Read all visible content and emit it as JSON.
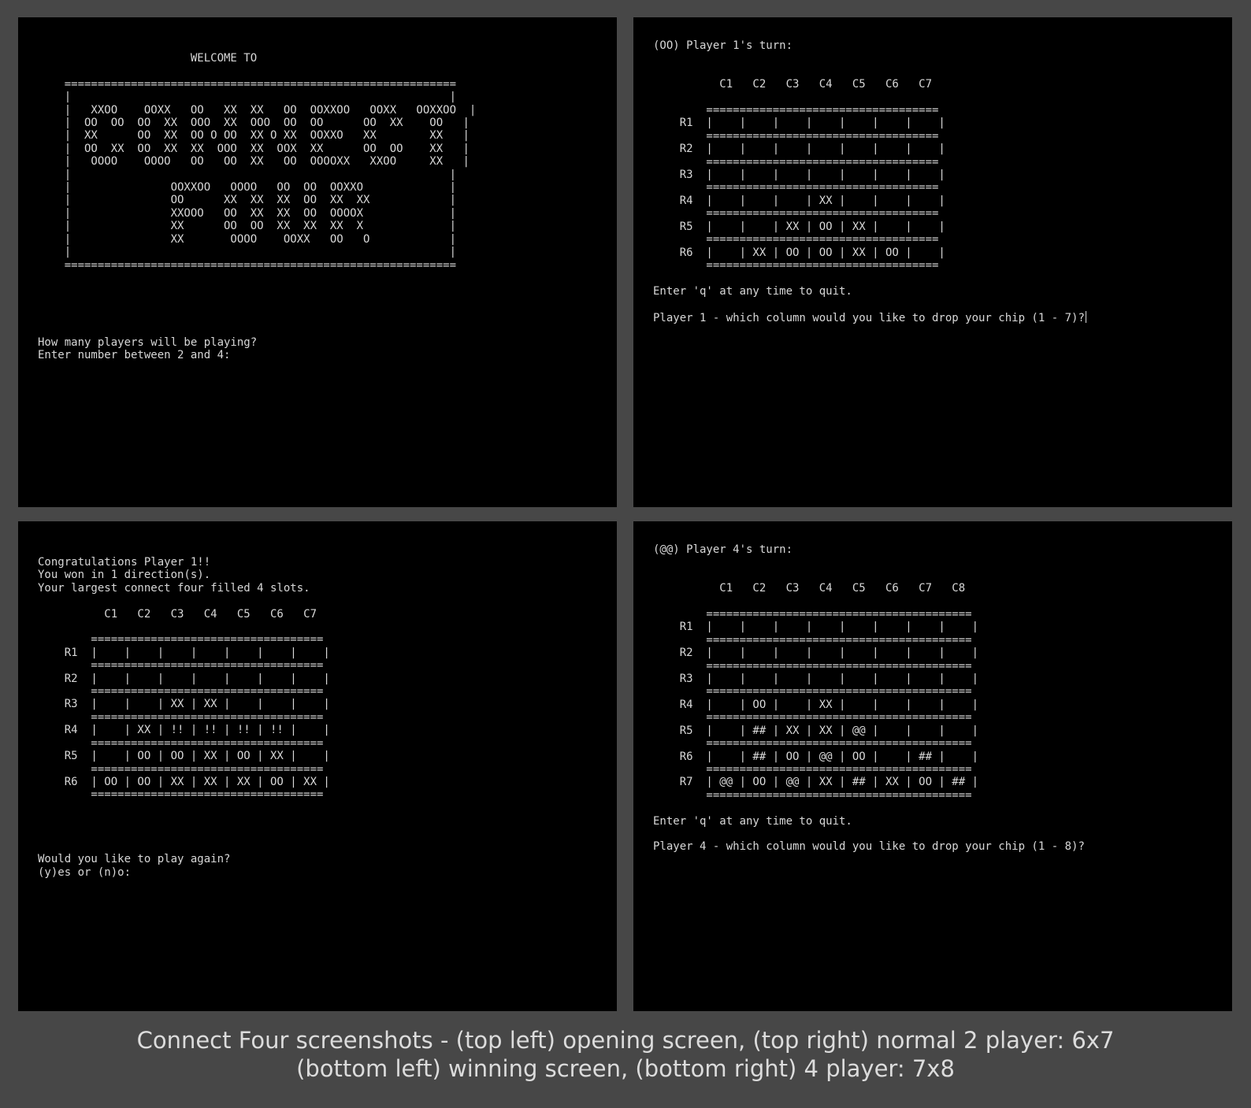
{
  "panels": {
    "opening": {
      "text": "                       WELCOME TO\n\n    ===========================================================\n    |                                                         |\n    |   XXOO    OOXX   OO   XX  XX   OO  OOXXOO   OOXX   OOXXOO  |\n    |  OO  OO  OO  XX  OOO  XX  OOO  OO  OO      OO  XX    OO   |\n    |  XX      OO  XX  OO O OO  XX O XX  OOXXO   XX        XX   |\n    |  OO  XX  OO  XX  XX  OOO  XX  OOX  XX      OO  OO    XX   |\n    |   OOOO    OOOO   OO   OO  XX   OO  OOOOXX   XXOO     XX   |\n    |                                                         |\n    |               OOXXOO   OOOO   OO  OO  OOXXO             |\n    |               OO      XX  XX  XX  OO  XX  XX            |\n    |               XXOOO   OO  XX  XX  OO  OOOOX             |\n    |               XX      OO  OO  XX  XX  XX  X             |\n    |               XX       OOOO    OOXX   OO   O            |\n    |                                                         |\n    ===========================================================\n\n\n\n\n\nHow many players will be playing?\nEnter number between 2 and 4:"
    },
    "two_player": {
      "text": "(OO) Player 1's turn:\n\n\n          C1   C2   C3   C4   C5   C6   C7\n\n        ===================================\n    R1  |    |    |    |    |    |    |    |\n        ===================================\n    R2  |    |    |    |    |    |    |    |\n        ===================================\n    R3  |    |    |    |    |    |    |    |\n        ===================================\n    R4  |    |    |    | XX |    |    |    |\n        ===================================\n    R5  |    |    | XX | OO | XX |    |    |\n        ===================================\n    R6  |    | XX | OO | OO | XX | OO |    |\n        ===================================\n\nEnter 'q' at any time to quit.\n\nPlayer 1 - which column would you like to drop your chip (1 - 7)?"
    },
    "winning": {
      "text": "Congratulations Player 1!!\nYou won in 1 direction(s).\nYour largest connect four filled 4 slots.\n\n          C1   C2   C3   C4   C5   C6   C7\n\n        ===================================\n    R1  |    |    |    |    |    |    |    |\n        ===================================\n    R2  |    |    |    |    |    |    |    |\n        ===================================\n    R3  |    |    | XX | XX |    |    |    |\n        ===================================\n    R4  |    | XX | !! | !! | !! | !! |    |\n        ===================================\n    R5  |    | OO | OO | XX | OO | XX |    |\n        ===================================\n    R6  | OO | OO | XX | XX | XX | OO | XX |\n        ===================================\n\n\n\n\nWould you like to play again?\n(y)es or (n)o:"
    },
    "four_player": {
      "text": "(@@) Player 4's turn:\n\n\n          C1   C2   C3   C4   C5   C6   C7   C8\n\n        ========================================\n    R1  |    |    |    |    |    |    |    |    |\n        ========================================\n    R2  |    |    |    |    |    |    |    |    |\n        ========================================\n    R3  |    |    |    |    |    |    |    |    |\n        ========================================\n    R4  |    | OO |    | XX |    |    |    |    |\n        ========================================\n    R5  |    | ## | XX | XX | @@ |    |    |    |\n        ========================================\n    R6  |    | ## | OO | @@ | OO |    | ## |    |\n        ========================================\n    R7  | @@ | OO | @@ | XX | ## | XX | OO | ## |\n        ========================================\n\nEnter 'q' at any time to quit.\n\nPlayer 4 - which column would you like to drop your chip (1 - 8)?"
    }
  },
  "caption": {
    "line1": "Connect Four screenshots - (top left) opening screen, (top right) normal 2 player: 6x7",
    "line2": "(bottom left) winning screen, (bottom right) 4 player: 7x8"
  },
  "colors": {
    "frame": "#474747",
    "console_bg": "#000000",
    "console_text": "#d8d8d8",
    "caption_text": "#dcdcdc"
  }
}
